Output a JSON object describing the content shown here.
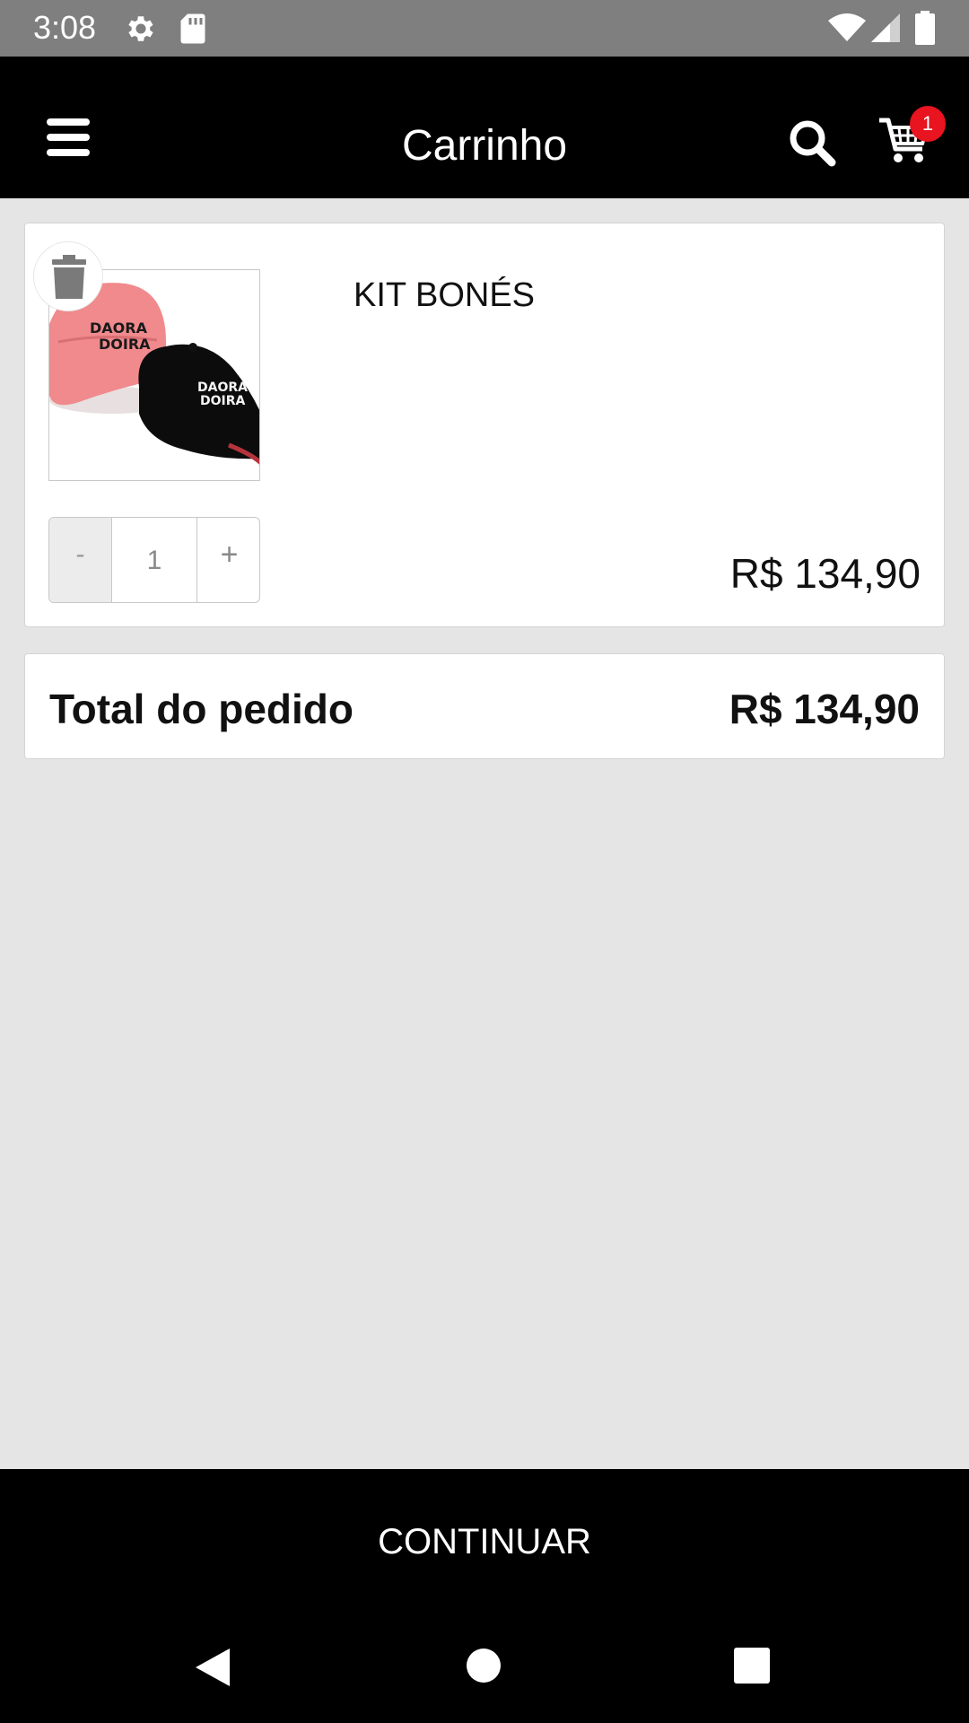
{
  "status_bar": {
    "time": "3:08",
    "icons": [
      "gear-icon",
      "sd-card-icon",
      "wifi-icon",
      "signal-icon",
      "battery-icon"
    ]
  },
  "app_bar": {
    "title": "Carrinho",
    "menu_icon": "hamburger-menu-icon",
    "search_icon": "search-icon",
    "cart_icon": "cart-icon",
    "cart_badge": "1",
    "badge_color": "#e8141f"
  },
  "cart": {
    "items": [
      {
        "name": "KIT BONÉS",
        "price": "R$ 134,90",
        "quantity": "1",
        "minus_label": "-",
        "plus_label": "+",
        "image_alt": "Kit with pink cap and black cap",
        "delete_icon": "trash-icon"
      }
    ],
    "total_label": "Total do pedido",
    "total_value": "R$ 134,90"
  },
  "continue_button": {
    "label": "CONTINUAR"
  },
  "nav_bar": {
    "icons": [
      "back-icon",
      "home-icon",
      "recents-icon"
    ]
  },
  "colors": {
    "app_bar_bg": "#000000",
    "page_bg": "#e5e5e5",
    "status_bar_bg": "#7f7f7f"
  }
}
